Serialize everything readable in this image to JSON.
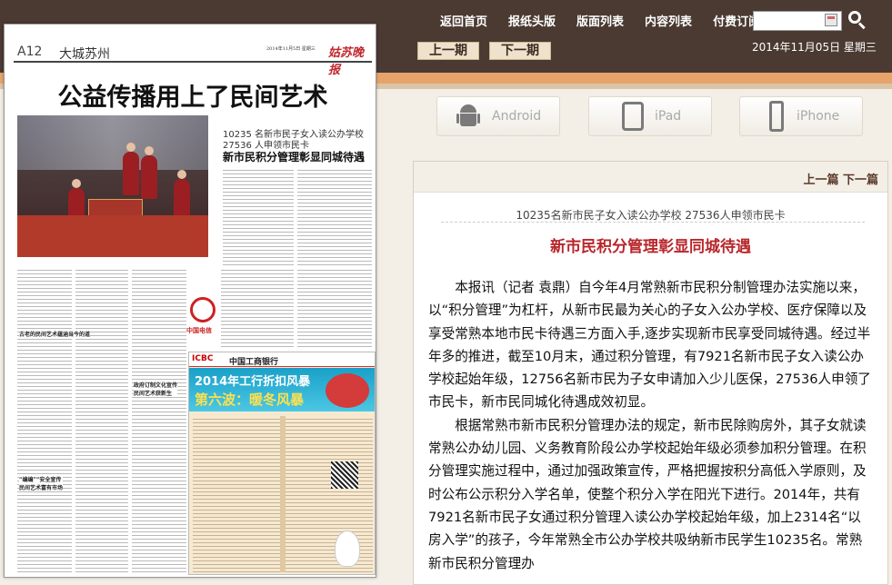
{
  "nav": {
    "items": [
      "返回首页",
      "报纸头版",
      "版面列表",
      "内容列表",
      "付费订阅"
    ]
  },
  "search": {
    "value": "",
    "placeholder": ""
  },
  "issue": {
    "prev_label": "上一期",
    "next_label": "下一期"
  },
  "date_text": "2014年11月05日  星期三",
  "devices": [
    "Android",
    "iPad",
    "iPhone"
  ],
  "paper": {
    "page_no": "A12",
    "section": "大城苏州",
    "masthead": "姑苏晚报",
    "page_date": "2014年11月5日 星期三",
    "headline": "公益传播用上了民间艺术",
    "sub_line1": "10235 名新市民子女入读公办学校",
    "sub_line2": "27536 人申领市民卡",
    "sub_title": "新市民积分管理彰显同城待遇",
    "subhead_1": "古老的民间艺术蕴涵当今的道",
    "subhead_2": "政府订制文化宣传\n民间艺术获新生",
    "subhead_3": "“编编”“安全宣传\n民间艺术富有市场",
    "ct_brand": "中国电信",
    "ad_bank": "中国工商银行",
    "ad_logo": "ICBC",
    "ad_title": "2014年工行折扣风暴",
    "ad_subtitle": "第六波：暖冬风暴"
  },
  "article": {
    "prev_next": "上一篇  下一篇",
    "subtitle": "10235名新市民子女入读公办学校    27536人申领市民卡",
    "title": "新市民积分管理彰显同城待遇",
    "paragraphs": [
      "本报讯（记者  袁鼎）自今年4月常熟新市民积分制管理办法实施以来，以“积分管理”为杠杆，从新市民最为关心的子女入公办学校、医疗保障以及享受常熟本地市民卡待遇三方面入手,逐步实现新市民享受同城待遇。经过半年多的推进，截至10月末，通过积分管理，有7921名新市民子女入读公办学校起始年级，12756名新市民为子女申请加入少儿医保，27536人申领了市民卡，新市民同城化待遇成效初显。",
      "根据常熟市新市民积分管理办法的规定，新市民除购房外，其子女就读常熟公办幼儿园、义务教育阶段公办学校起始年级必须参加积分管理。在积分管理实施过程中，通过加强政策宣传，严格把握按积分高低入学原则，及时公布公示积分入学名单，使整个积分入学在阳光下进行。2014年，共有7921名新市民子女通过积分管理入读公办学校起始年级，加上2314名“以房入学”的孩子，今年常熟全市公办学校共吸纳新市民学生10235名。常熟新市民积分管理办"
    ]
  }
}
